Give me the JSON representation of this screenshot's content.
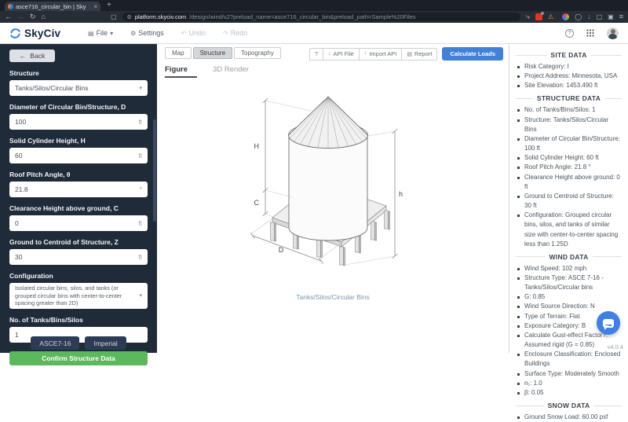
{
  "browser": {
    "tab_title": "asce716_circular_bin | Sky",
    "url_domain": "platform.skyciv.com",
    "url_path": "/design/wind/v2?preload_name=asce716_circular_bin&preload_path=Sample%20Files"
  },
  "icons": {
    "back_nav": "←",
    "forward_nav": "→",
    "reload": "↻",
    "home": "⌂",
    "bookmark": "▢",
    "tune": "⚙",
    "share": "⤷",
    "warning": "⚠",
    "download": "↓",
    "window": "▢",
    "pip": "▣",
    "menu": "≡",
    "close": "×",
    "plus": "+",
    "caret": "▾",
    "file": "▤",
    "gear": "⚙",
    "undo": "↶",
    "redo": "↷",
    "help": "?",
    "back_arrow": "←",
    "api_down": "↓",
    "api_up": "↑",
    "doc": "▤"
  },
  "header": {
    "brand": "SkyCiv",
    "file_menu": "File",
    "settings": "Settings",
    "undo": "Undo",
    "redo": "Redo"
  },
  "sidebar": {
    "back": "Back",
    "fields": [
      {
        "label": "Structure",
        "value": "Tanks/Silos/Circular Bins"
      },
      {
        "label": "Diameter of Circular Bin/Structure, D",
        "value": "100",
        "unit": "ft"
      },
      {
        "label": "Solid Cylinder Height, H",
        "value": "60",
        "unit": "ft"
      },
      {
        "label": "Roof Pitch Angle, θ",
        "value": "21.8",
        "unit": "°"
      },
      {
        "label": "Clearance Height above ground, C",
        "value": "0",
        "unit": "ft"
      },
      {
        "label": "Ground to Centroid of Structure, Z",
        "value": "30",
        "unit": "ft"
      },
      {
        "label": "Configuration",
        "value": "Isolated circular bins, silos, and tanks (or grouped circular bins with center-to-center spacing greater than 2D)"
      },
      {
        "label": "No. of Tanks/Bins/Silos",
        "value": "1"
      }
    ],
    "confirm": "Confirm Structure Data",
    "code_button": "ASCE7-16",
    "units_button": "Imperial"
  },
  "main": {
    "tabs": {
      "map": "Map",
      "structure": "Structure",
      "topography": "Topography"
    },
    "actions": {
      "help": "?",
      "api_file": "API File",
      "import_api": "Import API",
      "report": "Report",
      "calculate": "Calculate Loads"
    },
    "subtabs": {
      "figure": "Figure",
      "render": "3D Render"
    },
    "figure": {
      "caption": "Tanks/Silos/Circular Bins",
      "dim_H": "H",
      "dim_C": "C",
      "dim_h": "h",
      "dim_D": "D"
    }
  },
  "panel": {
    "sections": [
      {
        "title": "SITE DATA",
        "items": [
          "Risk Category: I",
          "Project Address: Minnesota, USA",
          "Site Elevation: 1453.490 ft"
        ]
      },
      {
        "title": "STRUCTURE DATA",
        "items": [
          "No. of Tanks/Bins/Silos: 1",
          "Structure: Tanks/Silos/Circular Bins",
          "Diameter of Circular Bin/Structure: 100 ft",
          "Solid Cylinder Height: 60 ft",
          "Roof Pitch Angle: 21.8 °",
          "Clearance Height above ground: 0 ft",
          "Ground to Centroid of Structure: 30 ft",
          "Configuration: Grouped circular bins, silos, and tanks of similar size with center-to-center spacing less than 1.25D"
        ]
      },
      {
        "title": "WIND DATA",
        "items": [
          "Wind Speed: 102 mph",
          "Structure Type: ASCE 7-16 - Tanks/Silos/Circular bins",
          "G: 0.85",
          "Wind Source Direction: N",
          "Type of Terrain: Flat",
          "Exposure Category: B",
          "Calculate Gust-effect Factor?: Assumed rigid (G = 0.85)",
          "Enclosure Classification: Enclosed Buildings",
          "Surface Type: Moderately Smooth",
          "n₁: 1.0",
          "β: 0.05"
        ]
      },
      {
        "title": "SNOW DATA",
        "items": [
          "Ground Snow Load: 60.00 psf"
        ]
      }
    ],
    "version": "v4.0.4"
  },
  "colors": {
    "accent_blue": "#4381d8",
    "confirm_green": "#5cb85c",
    "sidebar_bg": "#202b3a",
    "brand_navy": "#13263d",
    "caption_blue": "#7e94ab"
  }
}
